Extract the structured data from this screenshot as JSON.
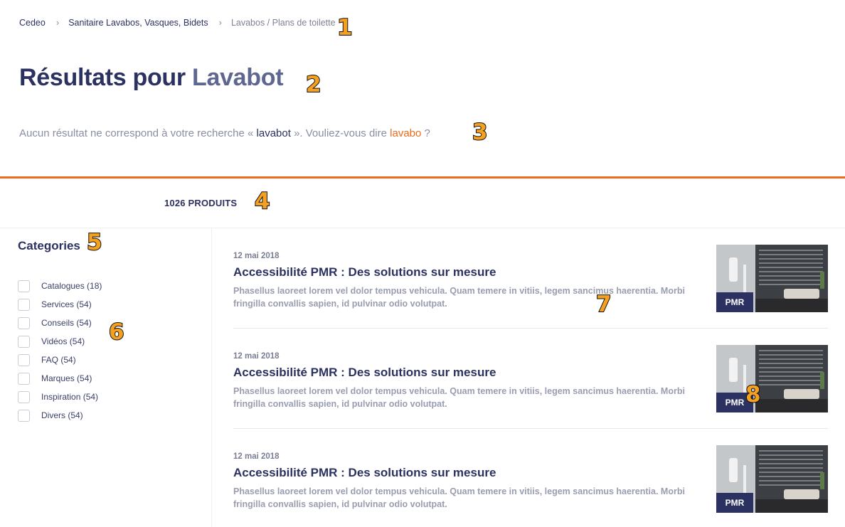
{
  "breadcrumb": {
    "items": [
      "Cedeo",
      "Sanitaire Lavabos, Vasques, Bidets"
    ],
    "separator": "›",
    "current": "Lavabos / Plans de toilette"
  },
  "header": {
    "title_prefix": "Résultats pour",
    "query": "Lavabot"
  },
  "suggestion": {
    "text_before": "Aucun résultat ne correspond à votre recherche « ",
    "term": "lavabot",
    "text_middle": " ». Vouliez-vous dire ",
    "link": "lavabo",
    "text_after": " ?"
  },
  "results_bar": {
    "count_label": "1026 PRODUITS"
  },
  "sidebar": {
    "title": "Categories",
    "categories": [
      "Catalogues (18)",
      "Services (54)",
      "Conseils (54)",
      "Vidéos (54)",
      "FAQ (54)",
      "Marques (54)",
      "Inspiration (54)",
      "Divers (54)"
    ]
  },
  "articles": [
    {
      "date": "12 mai 2018",
      "title": "Accessibilité PMR : Des solutions sur mesure",
      "excerpt": "Phasellus laoreet lorem vel dolor tempus vehicula. Quam temere in vitiis, legem sancimus haerentia. Morbi fringilla convallis sapien, id pulvinar odio volutpat.",
      "tag": "PMR"
    },
    {
      "date": "12 mai 2018",
      "title": "Accessibilité PMR : Des solutions sur mesure",
      "excerpt": "Phasellus laoreet lorem vel dolor tempus vehicula. Quam temere in vitiis, legem sancimus haerentia. Morbi fringilla convallis sapien, id pulvinar odio volutpat.",
      "tag": "PMR"
    },
    {
      "date": "12 mai 2018",
      "title": "Accessibilité PMR : Des solutions sur mesure",
      "excerpt": "Phasellus laoreet lorem vel dolor tempus vehicula. Quam temere in vitiis, legem sancimus haerentia. Morbi fringilla convallis sapien, id pulvinar odio volutpat.",
      "tag": "PMR"
    }
  ],
  "annotations": [
    "1",
    "2",
    "3",
    "4",
    "5",
    "6",
    "7",
    "8"
  ],
  "colors": {
    "primary": "#2b3160",
    "accent": "#ef6a1c",
    "muted": "#8a8ea3",
    "marker": "#f5a11f"
  }
}
